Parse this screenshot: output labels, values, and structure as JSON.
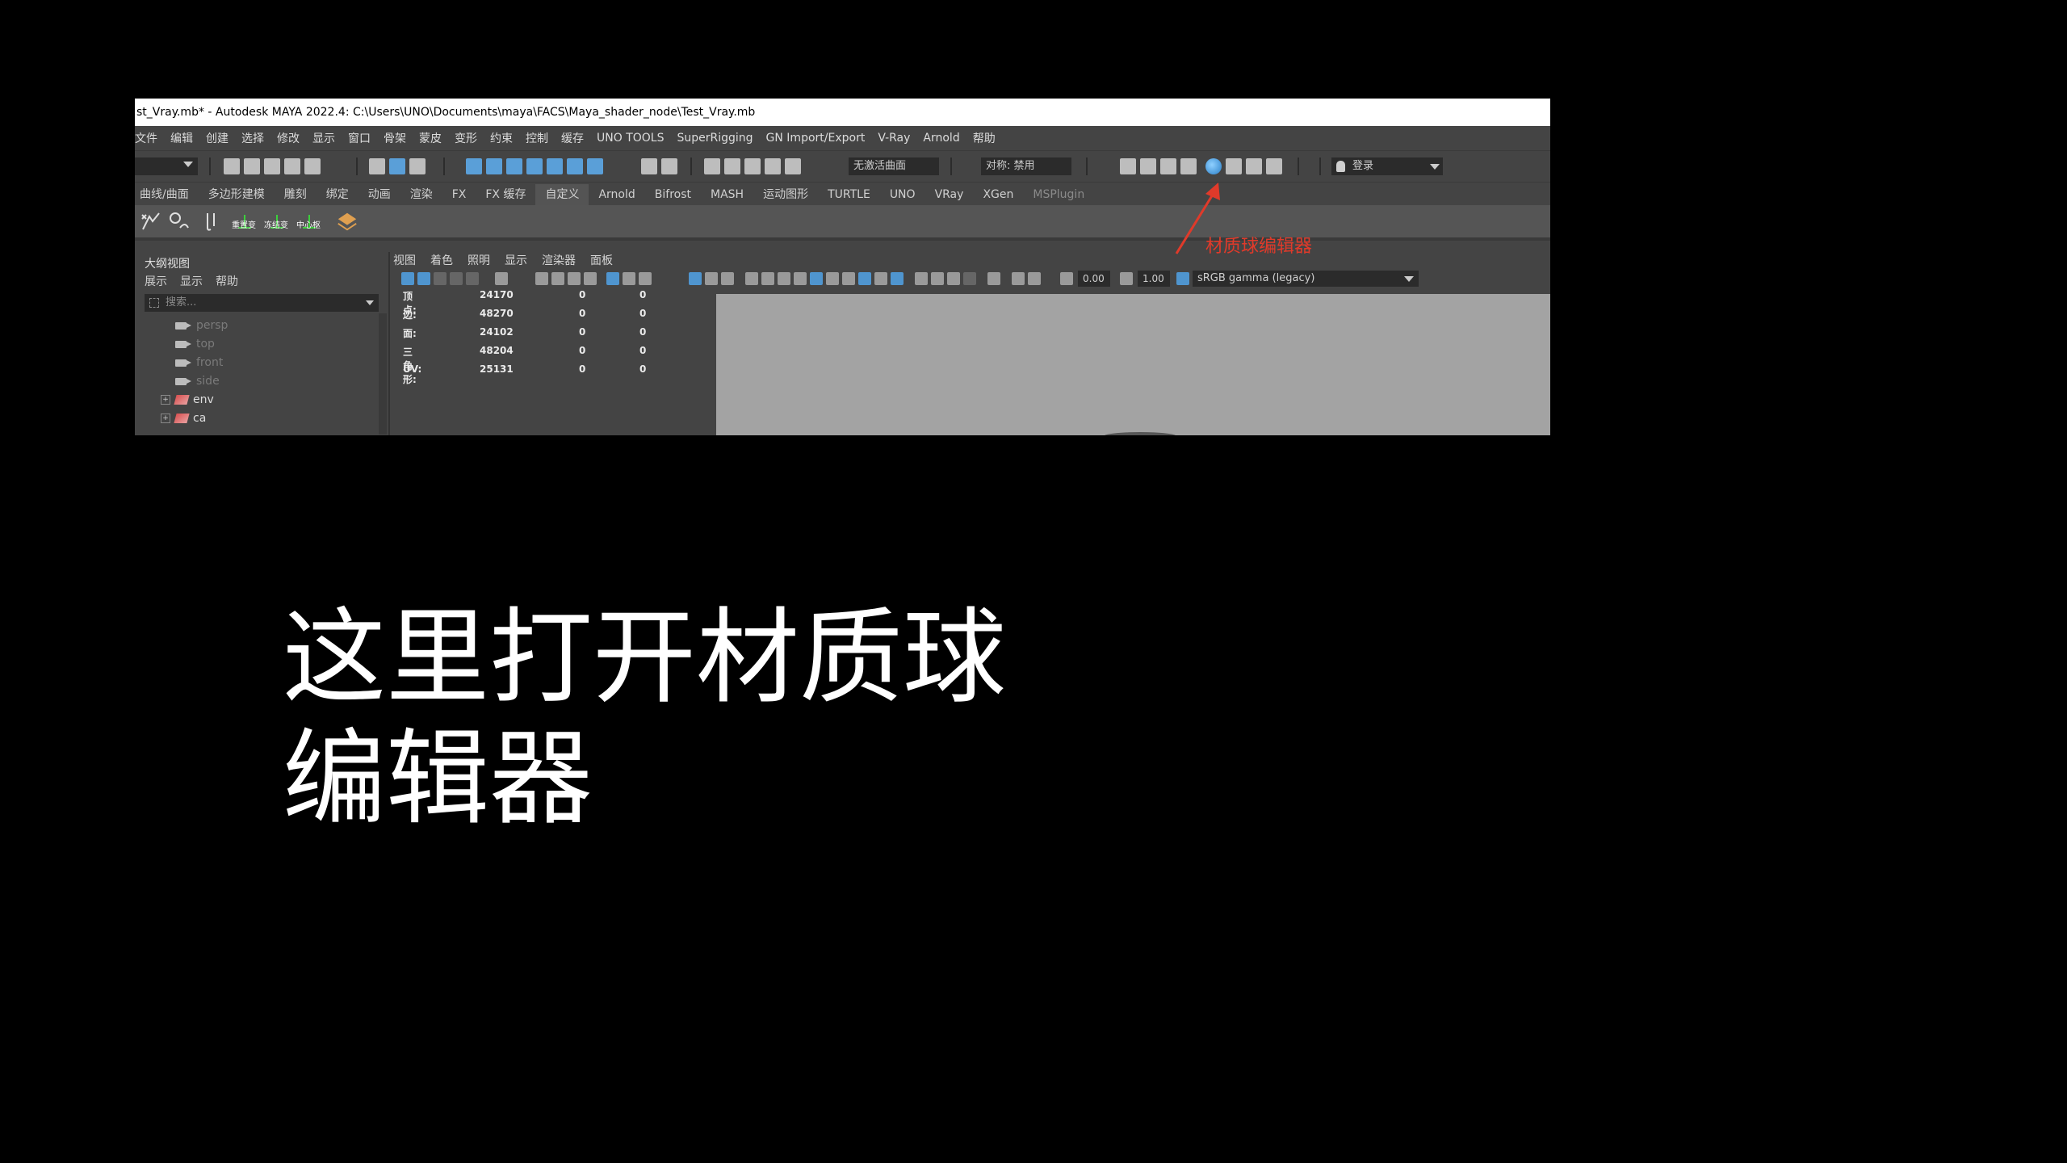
{
  "window": {
    "title": "st_Vray.mb* - Autodesk MAYA 2022.4: C:\\Users\\UNO\\Documents\\maya\\FACS\\Maya_shader_node\\Test_Vray.mb"
  },
  "menubar": [
    "文件",
    "编辑",
    "创建",
    "选择",
    "修改",
    "显示",
    "窗口",
    "骨架",
    "蒙皮",
    "变形",
    "约束",
    "控制",
    "缓存",
    "UNO TOOLS",
    "SuperRigging",
    "GN Import/Export",
    "V-Ray",
    "Arnold",
    "帮助"
  ],
  "statusline": {
    "live_surface": "无激活曲面",
    "symmetry": "对称: 禁用",
    "login": "登录",
    "logo": "UNO"
  },
  "shelf": {
    "tabs": [
      "曲线/曲面",
      "多边形建模",
      "雕刻",
      "绑定",
      "动画",
      "渲染",
      "FX",
      "FX 缓存",
      "自定义",
      "Arnold",
      "Bifrost",
      "MASH",
      "运动图形",
      "TURTLE",
      "UNO",
      "VRay",
      "XGen",
      "MSPlugin"
    ],
    "active_tab_index": 8,
    "button_labels": [
      "重置变",
      "冻结变",
      "中心枢"
    ]
  },
  "annotation": {
    "label": "材质球编辑器",
    "color": "#e03a2a"
  },
  "outliner": {
    "title": "大纲视图",
    "menu": [
      "展示",
      "显示",
      "帮助"
    ],
    "search_placeholder": "搜索...",
    "items": [
      {
        "name": "persp",
        "type": "camera",
        "dim": true
      },
      {
        "name": "top",
        "type": "camera",
        "dim": true
      },
      {
        "name": "front",
        "type": "camera",
        "dim": true
      },
      {
        "name": "side",
        "type": "camera",
        "dim": true
      },
      {
        "name": "env",
        "type": "group",
        "dim": false
      },
      {
        "name": "ca",
        "type": "group",
        "dim": false
      }
    ]
  },
  "viewport_panel": {
    "menu": [
      "视图",
      "着色",
      "照明",
      "显示",
      "渲染器",
      "面板"
    ],
    "exposure": "0.00",
    "gamma": "1.00",
    "color_space": "sRGB gamma (legacy)"
  },
  "hud_stats": [
    {
      "label": "顶点:",
      "values": [
        "24170",
        "0",
        "0"
      ]
    },
    {
      "label": "边:",
      "values": [
        "48270",
        "0",
        "0"
      ]
    },
    {
      "label": "面:",
      "values": [
        "24102",
        "0",
        "0"
      ]
    },
    {
      "label": "三角形:",
      "values": [
        "48204",
        "0",
        "0"
      ]
    },
    {
      "label": "UV:",
      "values": [
        "25131",
        "0",
        "0"
      ]
    }
  ],
  "caption": {
    "line1": "这里打开材质球",
    "line2": "编辑器"
  }
}
